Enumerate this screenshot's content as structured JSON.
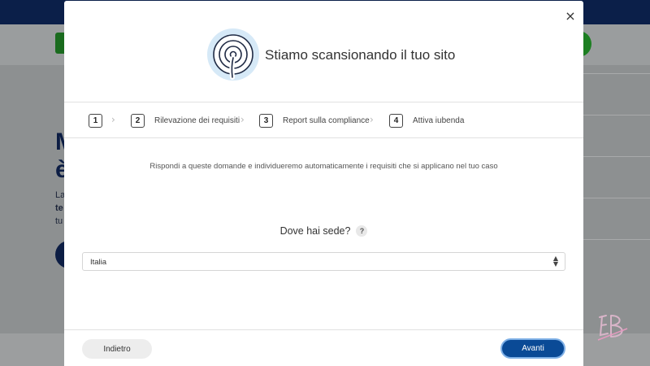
{
  "background": {
    "heading_line1": "M",
    "heading_line2": "è",
    "text_line1": "La",
    "text_line2": "te",
    "text_line3": "tu"
  },
  "modal": {
    "title": "Stiamo scansionando il tuo sito",
    "close_label": "×",
    "steps": [
      {
        "number": "1",
        "label": ""
      },
      {
        "number": "2",
        "label": "Rilevazione dei requisiti"
      },
      {
        "number": "3",
        "label": "Report sulla compliance"
      },
      {
        "number": "4",
        "label": "Attiva iubenda"
      }
    ],
    "instructions": "Rispondi a queste domande e individueremo automaticamente i requisiti che si applicano nel tuo caso",
    "question": {
      "label": "Dove hai sede?",
      "help": "?"
    },
    "select": {
      "value": "Italia"
    },
    "buttons": {
      "back": "Indietro",
      "next": "Avanti"
    }
  },
  "colors": {
    "primary": "#0a4a96",
    "topbar": "#0b1f49",
    "brand_green": "#1d7f22"
  },
  "icons": {
    "scan": "radar-scan-icon",
    "close": "close-icon",
    "chevron": "chevron-right-icon",
    "select_arrow": "updown-arrows-icon"
  }
}
